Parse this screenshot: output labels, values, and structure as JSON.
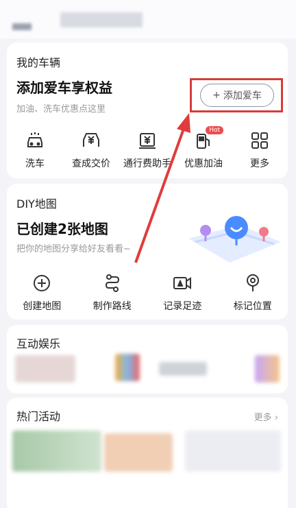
{
  "vehicle": {
    "section_title": "我的车辆",
    "headline": "添加爱车享权益",
    "subtext": "加油、洗车优惠点这里",
    "add_button": "添加爱车",
    "services": [
      {
        "label": "洗车",
        "icon": "car-wash-icon"
      },
      {
        "label": "查成交价",
        "icon": "price-car-icon"
      },
      {
        "label": "通行费助手",
        "icon": "toll-fee-icon"
      },
      {
        "label": "优惠加油",
        "icon": "fuel-pump-icon",
        "badge": "Hot"
      },
      {
        "label": "更多",
        "icon": "grid-more-icon"
      }
    ]
  },
  "diy": {
    "section_title": "DIY地图",
    "headline": "已创建2张地图",
    "subtext": "把你的地图分享给好友看看~",
    "actions": [
      {
        "label": "创建地图",
        "icon": "plus-circle-icon"
      },
      {
        "label": "制作路线",
        "icon": "route-icon"
      },
      {
        "label": "记录足迹",
        "icon": "video-record-icon"
      },
      {
        "label": "标记位置",
        "icon": "location-pin-icon"
      }
    ]
  },
  "fun": {
    "section_title": "互动娱乐"
  },
  "activity": {
    "section_title": "热门活动",
    "more": "更多"
  },
  "colors": {
    "highlight": "#d93a3a",
    "accent": "#3d7eff"
  }
}
